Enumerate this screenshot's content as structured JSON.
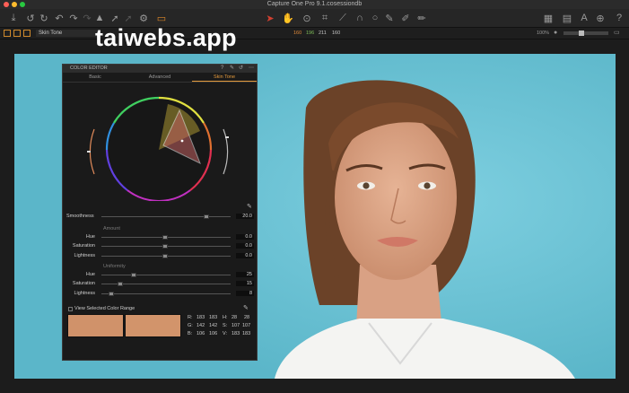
{
  "window": {
    "title": "Capture One Pro 9.1.cosessiondb"
  },
  "watermark": "taiwebs.app",
  "status_bar": {
    "preset": "Skin Tone",
    "readouts": [
      "160",
      "196",
      "211",
      "160"
    ],
    "zoom": "100%"
  },
  "toolbar": {
    "icons": [
      "import-icon",
      "rotate-left-icon",
      "rotate-right-icon",
      "undo-icon",
      "redo-icon",
      "redo-disabled-icon",
      "warning-icon",
      "arrow-icon",
      "arrow-disabled-icon",
      "gear-icon",
      "copy-layers-icon",
      "cursor-icon",
      "hand-icon",
      "zoom-icon",
      "crop-icon",
      "straighten-icon",
      "keystone-icon",
      "spot-icon",
      "picker-icon",
      "brush-icon",
      "eraser-icon",
      "grid-view-icon",
      "browser-icon",
      "text-icon",
      "globe-icon",
      "help-icon"
    ]
  },
  "color_editor": {
    "title": "COLOR EDITOR",
    "tabs": [
      "Basic",
      "Advanced",
      "Skin Tone"
    ],
    "active_tab": "Skin Tone",
    "smoothness": {
      "label": "Smoothness",
      "value": "20.0",
      "level": 0.86
    },
    "amount": {
      "heading": "Amount",
      "rows": [
        {
          "label": "Hue",
          "value": "0.0",
          "level": 0.5
        },
        {
          "label": "Saturation",
          "value": "0.0",
          "level": 0.5
        },
        {
          "label": "Lightness",
          "value": "0.0",
          "level": 0.5
        }
      ]
    },
    "uniformity": {
      "heading": "Uniformity",
      "rows": [
        {
          "label": "Hue",
          "value": "25",
          "level": 0.25
        },
        {
          "label": "Saturation",
          "value": "15",
          "level": 0.15
        },
        {
          "label": "Lightness",
          "value": "8",
          "level": 0.08
        }
      ]
    },
    "view_range_label": "View Selected Color Range",
    "swatch_color": "#d0926a",
    "swatch_color_2": "#d2946b",
    "rgb": {
      "r": "R:",
      "r1": "183",
      "r2": "183",
      "g": "G:",
      "g1": "142",
      "g2": "142",
      "b": "B:",
      "b1": "106",
      "b2": "106",
      "h": "H:",
      "h1": "28",
      "h2": "28",
      "s": "S:",
      "s1": "107",
      "s2": "107",
      "v": "V:",
      "v1": "183",
      "v2": "183"
    }
  },
  "colors": {
    "accent": "#e49a3c",
    "viewer_background": "#66c2d4"
  }
}
